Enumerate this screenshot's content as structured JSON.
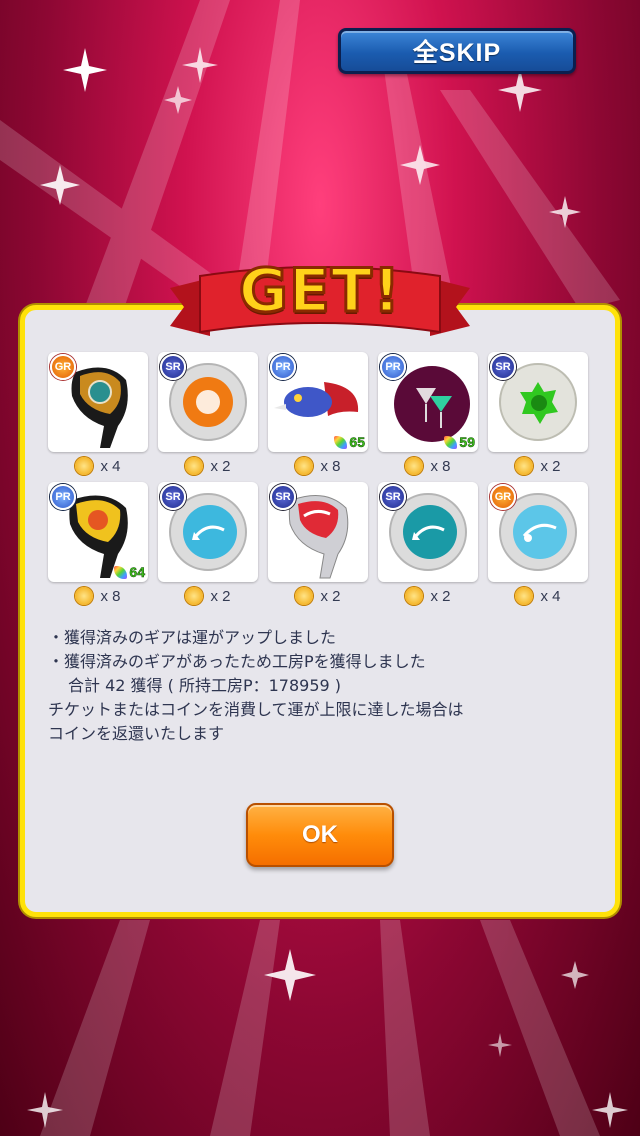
{
  "skip_button": {
    "label": "全SKIP"
  },
  "banner": {
    "text": "GET!"
  },
  "items": [
    {
      "rarity": "GR",
      "icon": "driver-club-icon",
      "count": "x 4",
      "luck": ""
    },
    {
      "rarity": "SR",
      "icon": "orange-emblem-ball-icon",
      "count": "x 2",
      "luck": ""
    },
    {
      "rarity": "PR",
      "icon": "dragon-ball-icon",
      "count": "x 8",
      "luck": "65"
    },
    {
      "rarity": "PR",
      "icon": "cocktail-ball-icon",
      "count": "x 8",
      "luck": "59"
    },
    {
      "rarity": "SR",
      "icon": "green-gear-ball-icon",
      "count": "x 2",
      "luck": ""
    },
    {
      "rarity": "PR",
      "icon": "yellow-driver-club-icon",
      "count": "x 8",
      "luck": "64"
    },
    {
      "rarity": "SR",
      "icon": "blue-arrow-ball-icon",
      "count": "x 2",
      "luck": ""
    },
    {
      "rarity": "SR",
      "icon": "red-driver-club-icon",
      "count": "x 2",
      "luck": ""
    },
    {
      "rarity": "SR",
      "icon": "teal-arrow-ball-icon",
      "count": "x 2",
      "luck": ""
    },
    {
      "rarity": "GR",
      "icon": "cyan-swirl-ball-icon",
      "count": "x 4",
      "luck": ""
    }
  ],
  "notes": {
    "line1": "・獲得済みのギアは運がアップしました",
    "line2": "・獲得済みのギアがあったため工房Pを獲得しました",
    "line3": "合計 42 獲得 ( 所持工房P：178959 )",
    "line4": "チケットまたはコインを消費して運が上限に達した場合は",
    "line5": "コインを返還いたします"
  },
  "ok_button": {
    "label": "OK"
  },
  "colors": {
    "background": "#d0124f",
    "dialog_border": "#ffe20a",
    "dialog_bg": "#e7e6ec",
    "ok_button": "#ff8c0a",
    "skip_button": "#1b5cb0"
  }
}
